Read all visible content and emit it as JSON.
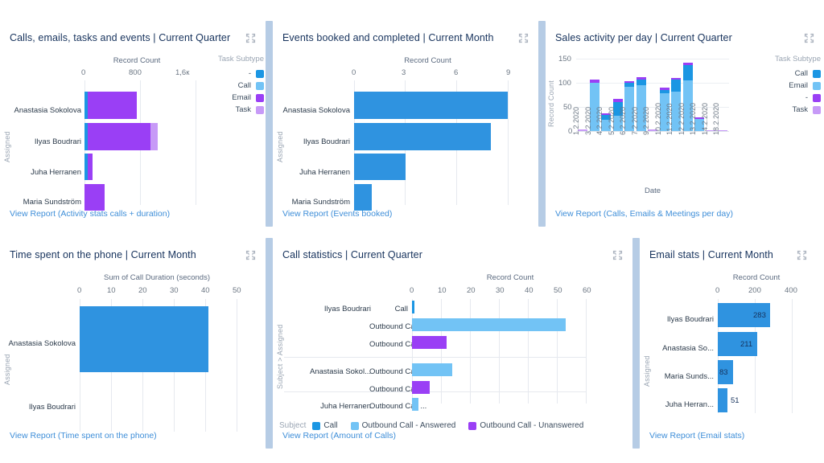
{
  "colors": {
    "call_dark": "#1b96e3",
    "call_light": "#72c3f5",
    "email_purple": "#9a3ff5",
    "task_lilac": "#c79af7",
    "bar_blue": "#2f93e0",
    "link": "#3e8ed8",
    "title": "#16325c",
    "divider": "#a9c3e0"
  },
  "cards": [
    {
      "id": "calls-emails-tasks-events",
      "title": "Calls, emails, tasks and events | Current Quarter",
      "footer": "View Report (Activity stats calls + duration)",
      "expand_icon": "expand-icon",
      "chart_data": {
        "type": "bar",
        "orientation": "horizontal",
        "stacked": true,
        "title": "Calls, emails, tasks and events | Current Quarter",
        "xlabel": "Record Count",
        "ylabel": "Assigned",
        "xlim": [
          0,
          1600
        ],
        "xticks": [
          0,
          800,
          1600
        ],
        "xticklabels": [
          "0",
          "800",
          "1,6к"
        ],
        "grid": true,
        "legend": {
          "title": "Task Subtype",
          "position": "right"
        },
        "categories": [
          "Anastasia Sokolova",
          "Ilyas Boudrari",
          "Juha Herranen",
          "Maria Sundström"
        ],
        "series": [
          {
            "name": "-",
            "color": "#1b96e3",
            "values": [
              40,
              30,
              40,
              0
            ]
          },
          {
            "name": "Call",
            "color": "#72c3f5",
            "values": [
              0,
              0,
              0,
              0
            ]
          },
          {
            "name": "Email",
            "color": "#9a3ff5",
            "values": [
              700,
              900,
              65,
              285
            ]
          },
          {
            "name": "Task",
            "color": "#c79af7",
            "values": [
              0,
              95,
              0,
              0
            ]
          }
        ]
      }
    },
    {
      "id": "events-booked-completed",
      "title": "Events booked and completed | Current Month",
      "footer": "View Report (Events booked)",
      "expand_icon": "expand-icon",
      "chart_data": {
        "type": "bar",
        "orientation": "horizontal",
        "stacked": false,
        "title": "Events booked and completed | Current Month",
        "xlabel": "Record Count",
        "ylabel": "Assigned",
        "xlim": [
          0,
          9
        ],
        "xticks": [
          0,
          3,
          6,
          9
        ],
        "xticklabels": [
          "0",
          "3",
          "6",
          "9"
        ],
        "grid": true,
        "categories": [
          "Anastasia Sokolova",
          "Ilyas Boudrari",
          "Juha Herranen",
          "Maria Sundström"
        ],
        "series": [
          {
            "name": "Record Count",
            "color": "#2f93e0",
            "values": [
              9,
              8,
              3,
              1
            ]
          }
        ]
      }
    },
    {
      "id": "sales-activity-per-day",
      "title": "Sales activity per day | Current Quarter",
      "footer": "View Report (Calls, Emails & Meetings per day)",
      "expand_icon": "expand-icon",
      "chart_data": {
        "type": "bar",
        "orientation": "vertical",
        "stacked": true,
        "title": "Sales activity per day | Current Quarter",
        "xlabel": "Date",
        "ylabel": "Record Count",
        "ylim": [
          0,
          160
        ],
        "yticks": [
          0,
          50,
          100,
          150
        ],
        "yticklabels": [
          "0",
          "50",
          "100",
          "150"
        ],
        "grid": true,
        "legend": {
          "title": "Task Subtype",
          "position": "right"
        },
        "categories": [
          "1.2.2020",
          "3.2.2020",
          "4.2.2020",
          "5.2.2020",
          "6.2.2020",
          "7.2.2020",
          "9.2.2020",
          "10.2.2020",
          "11.2.2020",
          "12.2.2020",
          "13.2.2020",
          "14.2.2020",
          "18.2.2020"
        ],
        "series": [
          {
            "name": "Call",
            "color": "#1b96e3",
            "values": [
              0,
              0,
              10,
              28,
              8,
              12,
              0,
              7,
              25,
              32,
              0,
              0,
              0
            ]
          },
          {
            "name": "Email",
            "color": "#72c3f5",
            "values": [
              0,
              100,
              23,
              31,
              92,
              96,
              0,
              78,
              81,
              104,
              25,
              0,
              0
            ]
          },
          {
            "name": "-",
            "color": "#9a3ff5",
            "values": [
              0,
              6,
              2,
              4,
              2,
              5,
              0,
              4,
              3,
              5,
              3,
              0,
              0
            ]
          },
          {
            "name": "Task",
            "color": "#c79af7",
            "values": [
              3,
              2,
              1,
              1,
              2,
              2,
              3,
              3,
              2,
              2,
              1,
              1,
              1
            ]
          }
        ]
      }
    },
    {
      "id": "time-spent-on-the-phone",
      "title": "Time spent on the phone | Current Month",
      "footer": "View Report (Time spent on the phone)",
      "expand_icon": "expand-icon",
      "chart_data": {
        "type": "bar",
        "orientation": "horizontal",
        "stacked": false,
        "title": "Time spent on the phone | Current Month",
        "xlabel": "Sum of Call Duration (seconds)",
        "ylabel": "Assigned",
        "xlim": [
          0,
          50
        ],
        "xticks": [
          0,
          10,
          20,
          30,
          40,
          50
        ],
        "xticklabels": [
          "0",
          "10",
          "20",
          "30",
          "40",
          "50"
        ],
        "grid": true,
        "categories": [
          "Anastasia Sokolova",
          "Ilyas Boudrari"
        ],
        "series": [
          {
            "name": "Sum of Call Duration (seconds)",
            "color": "#2f93e0",
            "values": [
              41,
              0
            ]
          }
        ]
      }
    },
    {
      "id": "call-statistics",
      "title": "Call statistics | Current Quarter",
      "footer": "View Report (Amount of Calls)",
      "expand_icon": "expand-icon",
      "chart_data": {
        "type": "bar",
        "orientation": "horizontal",
        "stacked": false,
        "title": "Call statistics | Current Quarter",
        "xlabel": "Record Count",
        "ylabel": "Subject > Assigned",
        "xlim": [
          0,
          60
        ],
        "xticks": [
          0,
          10,
          20,
          30,
          40,
          50,
          60
        ],
        "xticklabels": [
          "0",
          "10",
          "20",
          "30",
          "40",
          "50",
          "60"
        ],
        "grid": true,
        "legend": {
          "title": "Subject",
          "position": "bottom",
          "entries": [
            {
              "name": "Call",
              "color": "#1b96e3"
            },
            {
              "name": "Outbound Call - Answered",
              "color": "#72c3f5"
            },
            {
              "name": "Outbound Call - Unanswered",
              "color": "#9a3ff5"
            }
          ]
        },
        "groups": [
          {
            "assigned": "Ilyas Boudrari",
            "rows": [
              {
                "subject": "Call",
                "color": "#1b96e3",
                "value": 0.6
              },
              {
                "subject": "Outbound Call ...",
                "color": "#72c3f5",
                "value": 53
              },
              {
                "subject": "Outbound Call ...",
                "color": "#9a3ff5",
                "value": 12
              }
            ]
          },
          {
            "assigned": "Anastasia Sokol...",
            "rows": [
              {
                "subject": "Outbound Call ...",
                "color": "#72c3f5",
                "value": 14
              },
              {
                "subject": "Outbound Call ...",
                "color": "#9a3ff5",
                "value": 6
              }
            ]
          },
          {
            "assigned": "Juha Herranen",
            "rows": [
              {
                "subject": "Outbound Call ...",
                "color": "#72c3f5",
                "value": 2.3
              }
            ]
          }
        ]
      }
    },
    {
      "id": "email-stats",
      "title": "Email stats | Current Month",
      "footer": "View Report (Email stats)",
      "expand_icon": "expand-icon",
      "chart_data": {
        "type": "bar",
        "orientation": "horizontal",
        "stacked": false,
        "title": "Email stats | Current Month",
        "xlabel": "Record Count",
        "ylabel": "Assigned",
        "xlim": [
          0,
          400
        ],
        "xticks": [
          0,
          200,
          400
        ],
        "xticklabels": [
          "0",
          "200",
          "400"
        ],
        "grid": true,
        "show_values": true,
        "categories": [
          "Ilyas Boudrari",
          "Anastasia So...",
          "Maria Sunds...",
          "Juha Herran..."
        ],
        "series": [
          {
            "name": "Record Count",
            "color": "#2f93e0",
            "values": [
              283,
              211,
              83,
              51
            ]
          }
        ],
        "value_labels": [
          "283",
          "211",
          "83",
          "51"
        ]
      }
    }
  ]
}
